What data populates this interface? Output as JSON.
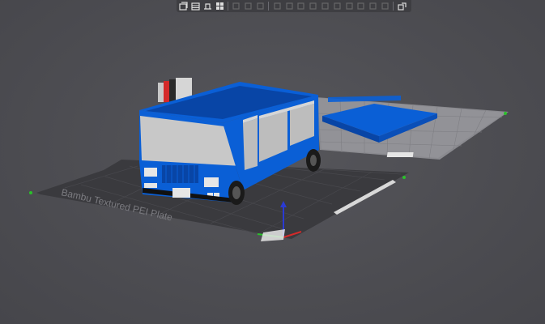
{
  "app": {
    "view": "3D Prepare view"
  },
  "toolbar": {
    "buttons": [
      {
        "name": "add-object-icon",
        "enabled": true
      },
      {
        "name": "add-plate-icon",
        "enabled": true
      },
      {
        "name": "auto-orient-icon",
        "enabled": true
      },
      {
        "name": "arrange-icon",
        "enabled": true
      },
      {
        "name": "split-objects-icon",
        "enabled": false
      },
      {
        "name": "split-parts-icon",
        "enabled": false
      },
      {
        "name": "layers-icon",
        "enabled": false
      },
      {
        "name": "move-icon",
        "enabled": false
      },
      {
        "name": "rotate-icon",
        "enabled": false
      },
      {
        "name": "scale-icon",
        "enabled": false
      },
      {
        "name": "lay-on-face-icon",
        "enabled": false
      },
      {
        "name": "cut-icon",
        "enabled": false
      },
      {
        "name": "support-paint-icon",
        "enabled": false
      },
      {
        "name": "seam-paint-icon",
        "enabled": false
      },
      {
        "name": "color-paint-icon",
        "enabled": false
      },
      {
        "name": "text-icon",
        "enabled": false
      },
      {
        "name": "measure-icon",
        "enabled": false
      },
      {
        "name": "assembly-view-icon",
        "enabled": true
      }
    ]
  },
  "plate": {
    "label": "Bambu Textured PEI Plate",
    "colors": {
      "active_plate": "#3a3a3e",
      "inactive_plate": "#8a8a8e",
      "grid": "#4f4f54"
    }
  },
  "model": {
    "object": "bus",
    "colors": {
      "body_blue": "#0a5fd6",
      "panel_grey": "#c8c8c8",
      "window_grey": "#bdbdbd",
      "tire": "#1a1a1a"
    }
  },
  "axes": {
    "colors": {
      "x": "#d42a2a",
      "y": "#2ac12a",
      "z": "#2a3ad4"
    }
  }
}
